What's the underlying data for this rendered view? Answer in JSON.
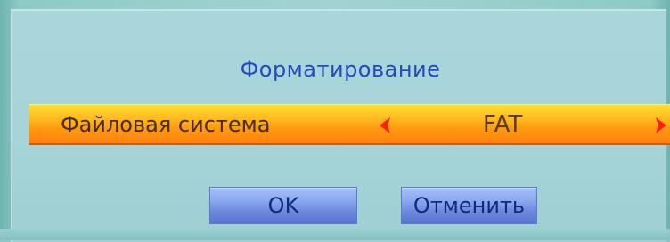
{
  "dialog": {
    "title": "Форматирование",
    "option": {
      "label": "Файловая система",
      "value": "FAT",
      "left_icon": "arrow-left-icon",
      "right_icon": "arrow-right-icon"
    },
    "buttons": {
      "ok_label": "OK",
      "cancel_label": "Отменить"
    }
  },
  "colors": {
    "dialog_bg": "#a8d5da",
    "title_text": "#2a48b8",
    "selection_gradient_top": "#ffe033",
    "selection_gradient_bottom": "#ff7e12",
    "arrow": "#ff2010",
    "button_bg": "#8ca9f0",
    "button_text": "#112a80"
  }
}
